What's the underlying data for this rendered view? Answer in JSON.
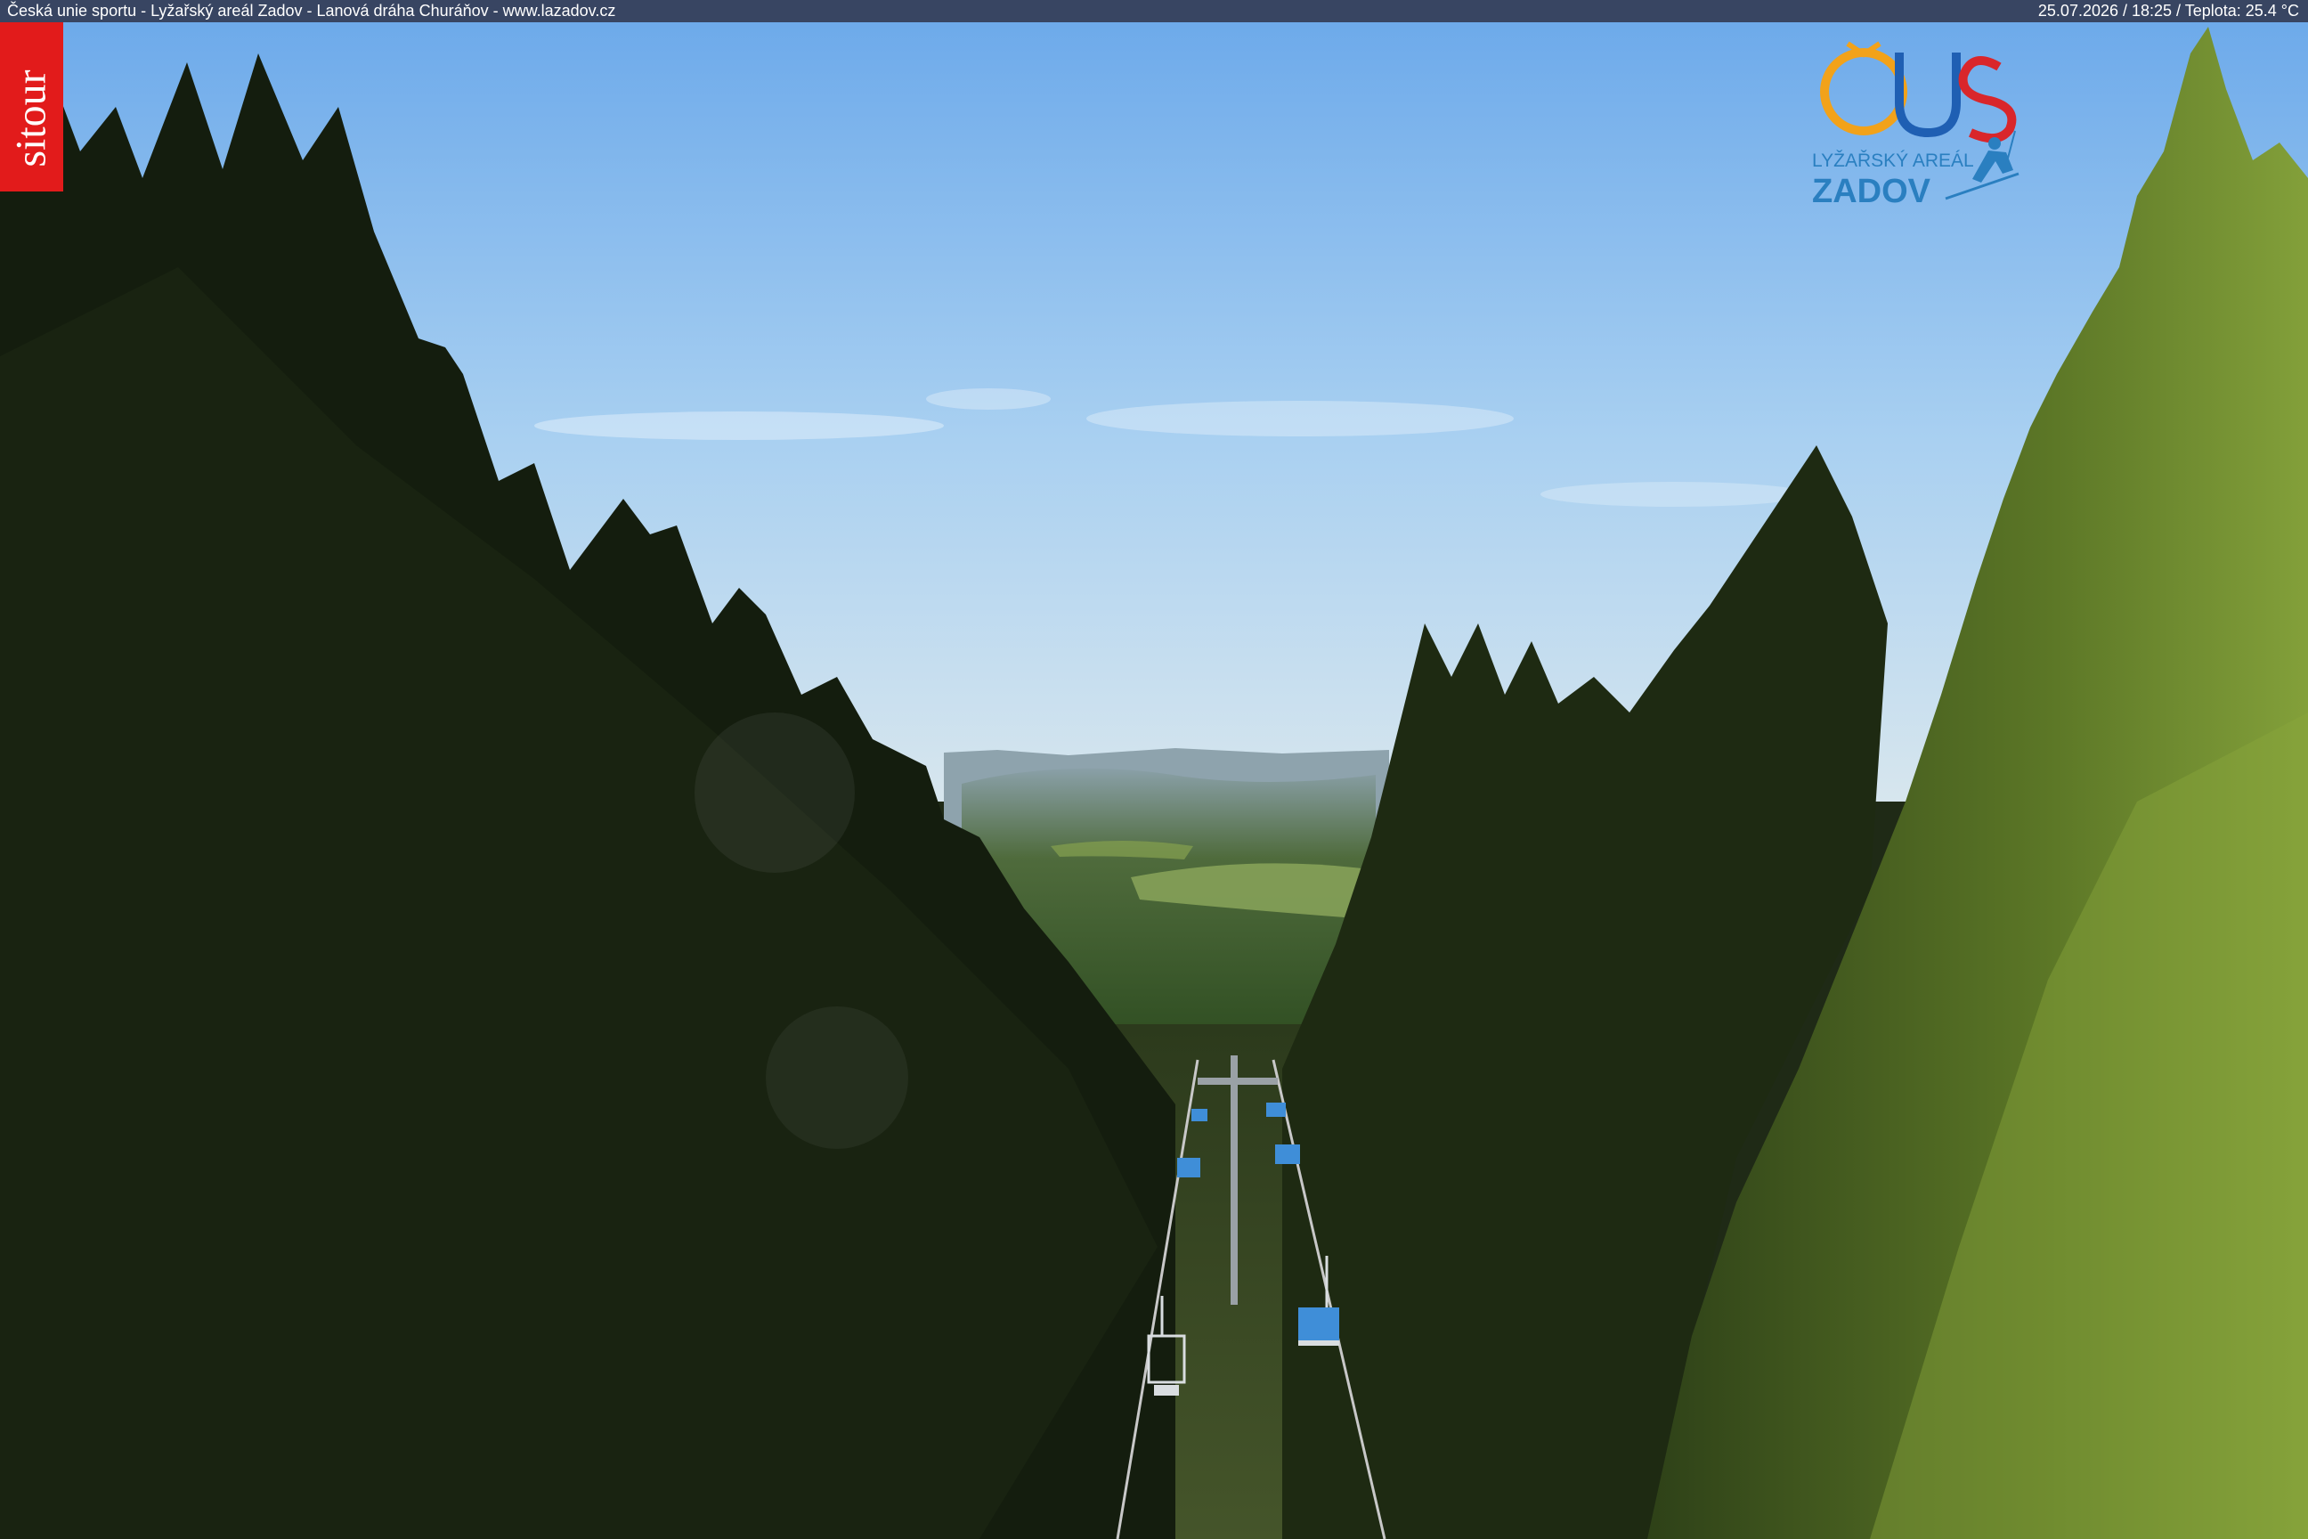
{
  "info_bar": {
    "caption": "Česká unie sportu - Lyžařský areál Zadov - Lanová dráha Churáňov - www.lazadov.cz",
    "date_time_temperature": "25.07.2026 / 18:25 / Teplota: 25.4 °C"
  },
  "brand_tab": {
    "text": "sitour",
    "color": "#e21b1b"
  },
  "logo": {
    "mark": "ČUS",
    "line1": "LYŽAŘSKÝ AREÁL",
    "line2": "ZADOV",
    "colors": {
      "ring_orange": "#f2a21a",
      "ring_red": "#d9262b",
      "ring_blue": "#1f5fb3",
      "text_blue": "#2a7fc0"
    }
  },
  "scene": {
    "sky_color": "#8fc0ee",
    "forest_shadow_color": "#16200f",
    "forest_lit_color": "#6f8a2e",
    "chairlift_color": "#3f8ed8"
  }
}
